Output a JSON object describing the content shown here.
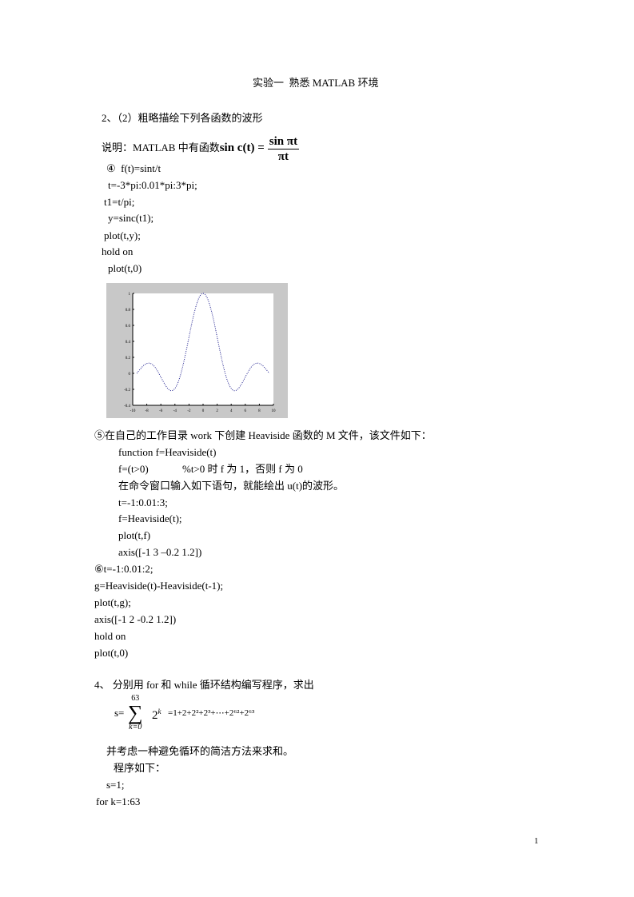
{
  "title": "实验一  熟悉 MATLAB 环境",
  "section2": "2、（2）粗略描绘下列各函数的波形",
  "note": {
    "prefix": "说明：MATLAB 中有函数",
    "lhs": "sin c(t) =",
    "num": "sin πt",
    "den": "πt"
  },
  "item4": {
    "head": "④  f(t)=sint/t",
    "code": [
      "t=-3*pi:0.01*pi:3*pi;",
      "t1=t/pi;",
      "y=sinc(t1);",
      "plot(t,y);",
      "hold on",
      "plot(t,0)"
    ]
  },
  "chart_data": {
    "type": "line",
    "x_range": [
      -10,
      10
    ],
    "ylim": [
      -0.4,
      1
    ],
    "xticks": [
      -10,
      -8,
      -6,
      -4,
      -2,
      0,
      2,
      4,
      6,
      8,
      10
    ],
    "yticks": [
      -0.4,
      -0.2,
      0,
      0.2,
      0.4,
      0.6,
      0.8,
      1
    ],
    "series": [
      {
        "function": "sin(t)/t",
        "t_range": [
          -9.42,
          9.42
        ],
        "color": "#1a1a8c",
        "style": "dotted"
      }
    ],
    "grid": false
  },
  "item5": {
    "head": "⑤在自己的工作目录 work 下创建 Heaviside 函数的 M 文件，该文件如下：",
    "code": [
      "function f=Heaviside(t)",
      "f=(t>0)             %t>0 时 f 为 1，否则 f 为 0",
      "在命令窗口输入如下语句，就能绘出 u(t)的波形。",
      "t=-1:0.01:3;",
      "f=Heaviside(t);",
      "plot(t,f)",
      "axis([-1 3 –0.2 1.2])"
    ]
  },
  "item6": {
    "head": "⑥t=-1:0.01:2;",
    "code": [
      "g=Heaviside(t)-Heaviside(t-1);",
      "plot(t,g);",
      "axis([-1 2 -0.2 1.2])",
      "hold on",
      "plot(t,0)"
    ]
  },
  "section4": "4、 分别用 for 和 while 循环结构编写程序，求出",
  "formula": {
    "lhs": "s=",
    "upper": "63",
    "lower": "k=0",
    "term": "2",
    "exp": "k",
    "rhs": "=1+2+2²+2³+⋯+2⁶²+2⁶³"
  },
  "after": [
    "并考虑一种避免循环的简洁方法来求和。",
    "程序如下：",
    "s=1;",
    "for k=1:63"
  ],
  "page_number": "1"
}
